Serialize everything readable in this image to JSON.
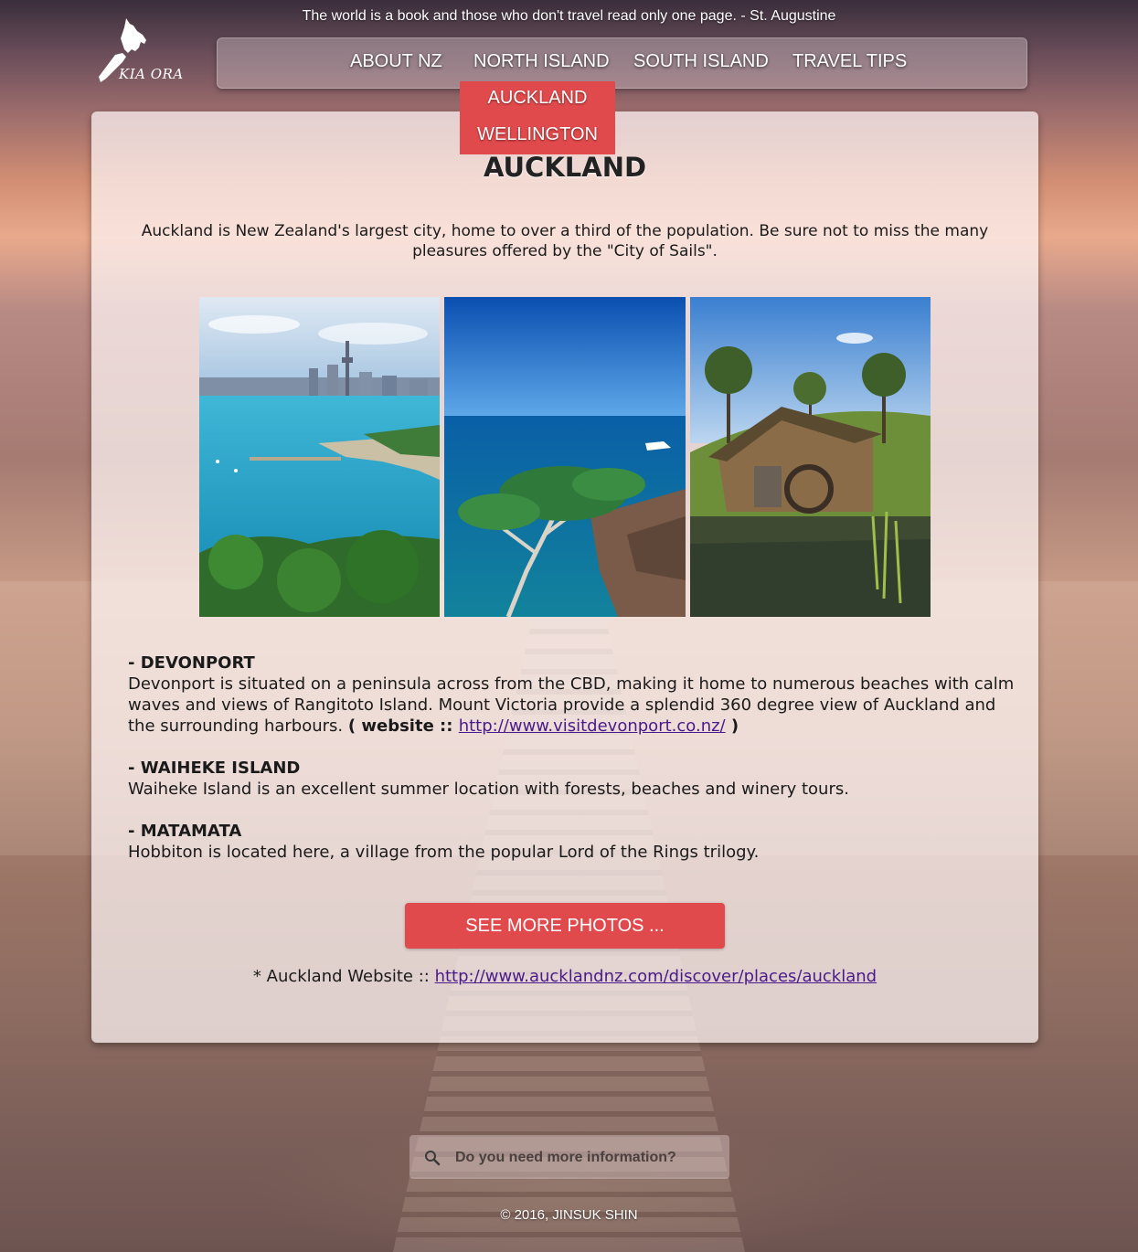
{
  "header": {
    "quote": "The world is a book and those who don't travel read only one page.  - St. Augustine",
    "logo_text": "KIA ORA",
    "logo_icon": "nz-map-icon"
  },
  "nav": {
    "items": [
      {
        "label": "ABOUT NZ"
      },
      {
        "label": "NORTH ISLAND"
      },
      {
        "label": "SOUTH ISLAND"
      },
      {
        "label": "TRAVEL TIPS"
      }
    ],
    "dropdown": [
      {
        "label": "AUCKLAND"
      },
      {
        "label": "WELLINGTON"
      }
    ]
  },
  "main": {
    "title": "AUCKLAND",
    "intro": "Auckland is New Zealand's largest city, home to over a third of the population. Be sure not to miss the many pleasures offered by the \"City of Sails\".",
    "sections": [
      {
        "title": "- DEVONPORT",
        "text": "Devonport is situated on a peninsula across from the CBD, making it home to numerous beaches with calm waves and views of Rangitoto Island. Mount Victoria provide a splendid 360 degree view of Auckland and the surrounding harbours. ",
        "link_prefix_open": "( ",
        "link_label": "website",
        "link_sep": " :: ",
        "link_url": "http://www.visitdevonport.co.nz/",
        "link_close": " )"
      },
      {
        "title": "- WAIHEKE ISLAND",
        "text": "Waiheke Island is an excellent summer location with forests, beaches and winery tours."
      },
      {
        "title": "- MATAMATA",
        "text": "Hobbiton is located here, a village from the popular Lord of the Rings trilogy."
      }
    ],
    "more_button": "SEE MORE PHOTOS ...",
    "site_prefix": "* Auckland Website :: ",
    "site_url": "http://www.aucklandnz.com/discover/places/auckland"
  },
  "search": {
    "placeholder": "Do you need more information?",
    "icon": "search-icon"
  },
  "footer": {
    "copyright": "© 2016, JINSUK SHIN"
  },
  "colors": {
    "accent": "#e14a4c",
    "link": "#4a1a8a"
  }
}
